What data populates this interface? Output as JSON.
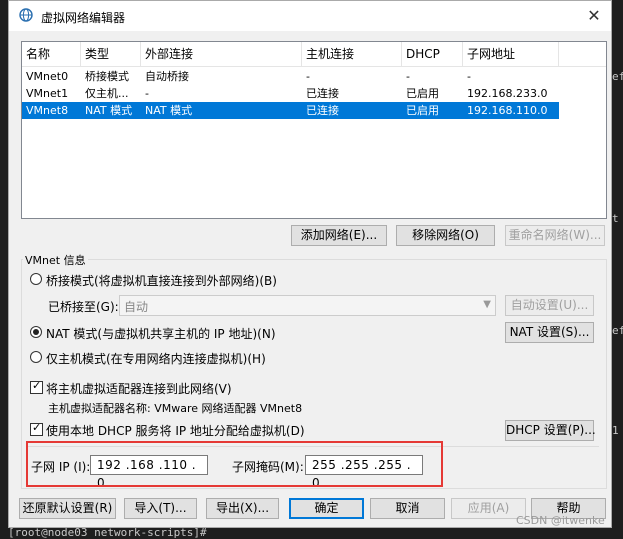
{
  "window": {
    "title": "虚拟网络编辑器",
    "close_glyph": "✕"
  },
  "netlist": {
    "columns": [
      "名称",
      "类型",
      "外部连接",
      "主机连接",
      "DHCP",
      "子网地址"
    ],
    "rows": [
      [
        "VMnet0",
        "桥接模式",
        "自动桥接",
        "-",
        "-",
        "-"
      ],
      [
        "VMnet1",
        "仅主机...",
        "-",
        "已连接",
        "已启用",
        "192.168.233.0"
      ],
      [
        "VMnet8",
        "NAT 模式",
        "NAT 模式",
        "已连接",
        "已启用",
        "192.168.110.0"
      ]
    ],
    "selected_index": 2
  },
  "list_buttons": {
    "add": "添加网络(E)...",
    "remove": "移除网络(O)",
    "rename": "重命名网络(W)..."
  },
  "vmnet_info": {
    "group_label": "VMnet 信息",
    "bridged_label": "桥接模式(将虚拟机直接连接到外部网络)(B)",
    "bridged_to_label": "已桥接至(G):",
    "bridged_to_value": "自动",
    "auto_settings": "自动设置(U)...",
    "nat_label": "NAT 模式(与虚拟机共享主机的 IP 地址)(N)",
    "nat_settings": "NAT 设置(S)...",
    "hostonly_label": "仅主机模式(在专用网络内连接虚拟机)(H)",
    "selected_mode": "nat",
    "connect_adapter_label": "将主机虚拟适配器连接到此网络(V)",
    "adapter_name_label": "主机虚拟适配器名称: VMware 网络适配器 VMnet8",
    "dhcp_label": "使用本地 DHCP 服务将 IP 地址分配给虚拟机(D)",
    "dhcp_settings": "DHCP 设置(P)...",
    "subnet_ip_label": "子网 IP (I):",
    "subnet_ip": "192 .168 .110 . 0",
    "subnet_mask_label": "子网掩码(M):",
    "subnet_mask": "255 .255 .255 . 0"
  },
  "bottom_buttons": {
    "restore": "还原默认设置(R)",
    "import": "导入(T)...",
    "export": "导出(X)...",
    "ok": "确定",
    "cancel": "取消",
    "apply": "应用(A)",
    "help": "帮助"
  },
  "terminal": {
    "bottom_text": "[root@node03 network-scripts]#",
    "right_chars": [
      "ef",
      "t",
      "ef",
      "1"
    ]
  },
  "watermark": "CSDN @itwenke",
  "colors": {
    "selection": "#0078d7",
    "highlight_box": "#e53935"
  }
}
